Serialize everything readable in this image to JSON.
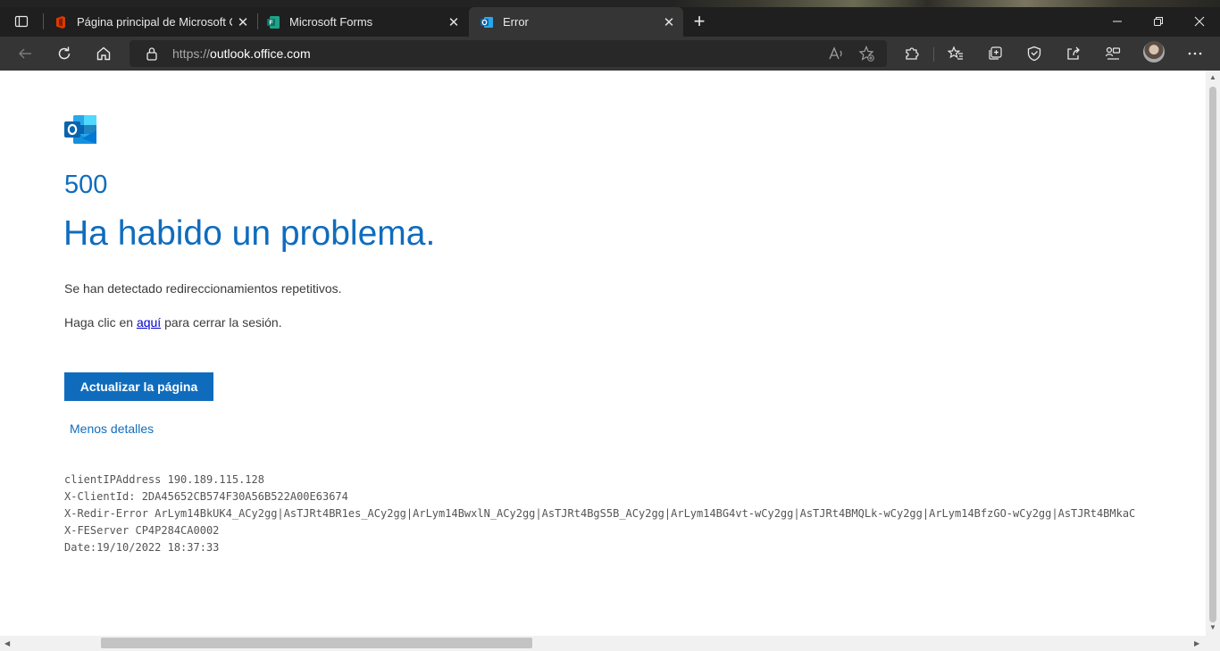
{
  "browser": {
    "tabs": [
      {
        "title": "Página principal de Microsoft Office",
        "icon": "office-icon"
      },
      {
        "title": "Microsoft Forms",
        "icon": "forms-icon"
      },
      {
        "title": "Error",
        "icon": "outlook-icon",
        "active": true
      }
    ],
    "close_glyph": "✕",
    "newtab_glyph": "+",
    "url_protocol": "https://",
    "url_host": "outlook.office.com"
  },
  "page": {
    "error_code": "500",
    "title": "Ha habido un problema.",
    "message_redirects": "Se han detectado redireccionamientos repetitivos.",
    "signout_prefix": "Haga clic en ",
    "signout_link": "aquí",
    "signout_suffix": " para cerrar la sesión.",
    "refresh_button": "Actualizar la página",
    "details_toggle": "Menos detalles",
    "diagnostics": [
      "clientIPAddress 190.189.115.128",
      "X-ClientId: 2DA45652CB574F30A56B522A00E63674",
      "X-Redir-Error ArLym14BkUK4_ACy2gg|AsTJRt4BR1es_ACy2gg|ArLym14BwxlN_ACy2gg|AsTJRt4BgS5B_ACy2gg|ArLym14BG4vt-wCy2gg|AsTJRt4BMQLk-wCy2gg|ArLym14BfzGO-wCy2gg|AsTJRt4BMkaC",
      "X-FEServer CP4P284CA0002",
      "Date:19/10/2022 18:37:33"
    ]
  }
}
